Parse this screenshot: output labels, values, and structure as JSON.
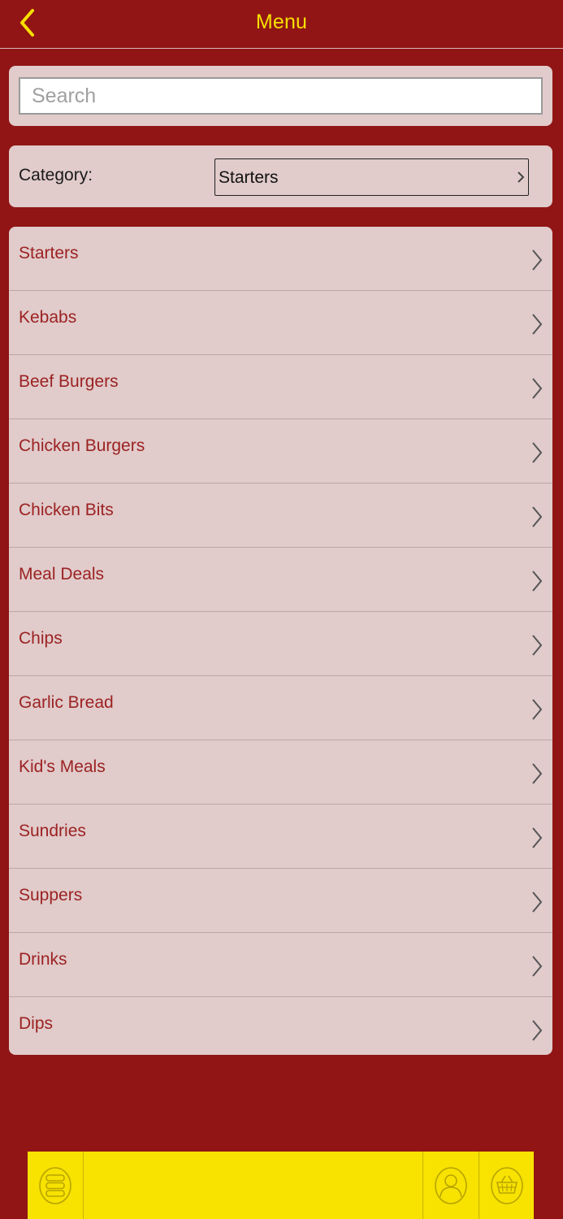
{
  "header": {
    "title": "Menu",
    "back_icon": "chevron-left-icon"
  },
  "search": {
    "placeholder": "Search",
    "value": ""
  },
  "category": {
    "label": "Category:",
    "selected": "Starters"
  },
  "items": [
    {
      "label": "Starters"
    },
    {
      "label": "Kebabs"
    },
    {
      "label": "Beef Burgers"
    },
    {
      "label": "Chicken Burgers"
    },
    {
      "label": "Chicken Bits"
    },
    {
      "label": "Meal Deals"
    },
    {
      "label": "Chips"
    },
    {
      "label": "Garlic Bread"
    },
    {
      "label": "Kid's Meals"
    },
    {
      "label": "Sundries"
    },
    {
      "label": "Suppers"
    },
    {
      "label": "Drinks"
    },
    {
      "label": "Dips"
    }
  ],
  "footer": {
    "icons": [
      "menu-list-icon",
      "user-icon",
      "basket-icon"
    ]
  },
  "colors": {
    "background": "#911515",
    "accent": "#f7e000",
    "panel": "#e1cbcb",
    "item_text": "#9c2222",
    "footer": "#f7e200"
  }
}
